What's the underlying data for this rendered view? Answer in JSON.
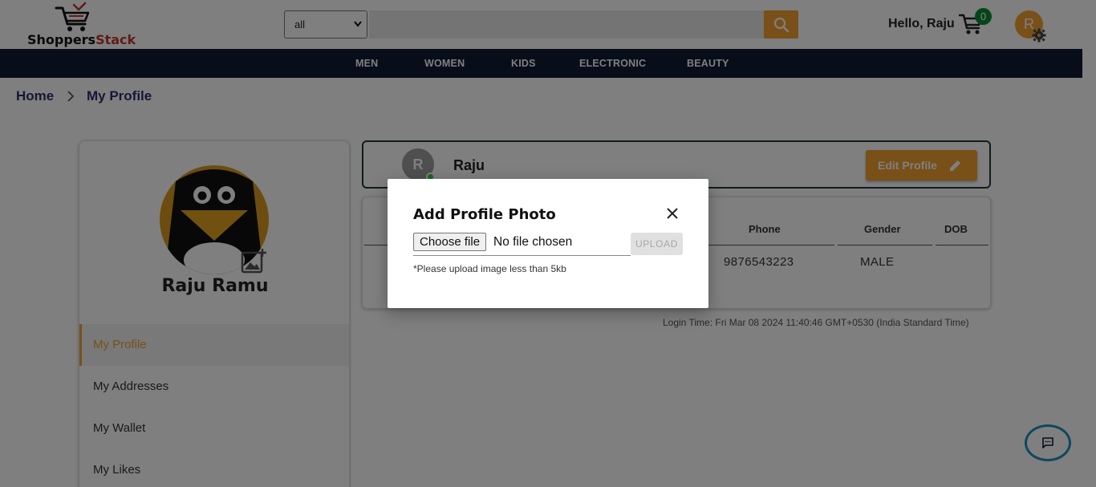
{
  "header": {
    "brand_part1": "Shoppers",
    "brand_part2": "Stack",
    "search_category": "all",
    "search_placeholder": "",
    "greeting": "Hello, Raju",
    "cart_count": "0",
    "user_initial": "R"
  },
  "nav": {
    "items": [
      {
        "label": "MEN"
      },
      {
        "label": "WOMEN"
      },
      {
        "label": "KIDS"
      },
      {
        "label": "ELECTRONIC"
      },
      {
        "label": "BEAUTY"
      }
    ]
  },
  "breadcrumb": {
    "home": "Home",
    "current": "My Profile"
  },
  "sidebar": {
    "name": "Raju Ramu",
    "items": [
      {
        "label": "My Profile",
        "active": true
      },
      {
        "label": "My Addresses"
      },
      {
        "label": "My Wallet"
      },
      {
        "label": "My Likes"
      }
    ]
  },
  "profile": {
    "avatar_initial": "R",
    "name": "Raju",
    "edit_label": "Edit Profile",
    "columns": [
      "Phone",
      "Gender",
      "DOB"
    ],
    "values": {
      "phone": "9876543223",
      "gender": "MALE",
      "dob": ""
    },
    "login_time": "Login Time: Fri Mar 08 2024 11:40:46 GMT+0530 (India Standard Time)"
  },
  "modal": {
    "title": "Add Profile Photo",
    "choose_label": "Choose file",
    "no_file_text": "No file chosen",
    "upload_label": "UPLOAD",
    "hint": "*Please upload image less than 5kb"
  },
  "colors": {
    "accent": "#f0a030",
    "nav_bg": "#0f1a33",
    "badge_green": "#0b8a2e"
  }
}
